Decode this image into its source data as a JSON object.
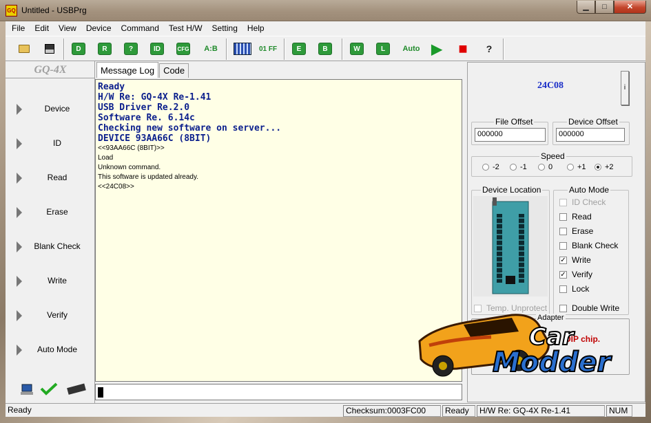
{
  "window": {
    "title": "Untitled - USBPrg",
    "app_icon": "GQ"
  },
  "window_controls": {
    "min": "▁",
    "max": "□",
    "close": "✕"
  },
  "menu": [
    "File",
    "Edit",
    "View",
    "Device",
    "Command",
    "Test H/W",
    "Setting",
    "Help"
  ],
  "toolbar": {
    "buttons": [
      {
        "name": "open-icon",
        "glyph": "📂"
      },
      {
        "name": "save-icon",
        "glyph": "💾"
      },
      {
        "name": "device-chip-icon",
        "glyph": "D"
      },
      {
        "name": "read-chip-icon",
        "glyph": "R"
      },
      {
        "name": "verify-chip-icon",
        "glyph": "?"
      },
      {
        "name": "id-chip-icon",
        "glyph": "ID"
      },
      {
        "name": "cfg-chip-icon",
        "glyph": "CFG"
      },
      {
        "name": "compare-icon",
        "glyph": "A:B"
      },
      {
        "name": "calculator-icon",
        "glyph": "▦"
      },
      {
        "name": "fill-01ff-icon",
        "glyph": "01 FF"
      },
      {
        "name": "erase-chip-icon",
        "glyph": "E"
      },
      {
        "name": "blank-chip-icon",
        "glyph": "B"
      },
      {
        "name": "write-chip-icon",
        "glyph": "W"
      },
      {
        "name": "lock-chip-icon",
        "glyph": "L"
      },
      {
        "name": "auto-icon",
        "glyph": "Auto"
      },
      {
        "name": "run-icon",
        "glyph": "▶"
      },
      {
        "name": "stop-icon",
        "glyph": "■"
      },
      {
        "name": "help-icon",
        "glyph": "?"
      }
    ]
  },
  "sidebar": {
    "logo": "GQ-4X",
    "items": [
      "Device",
      "ID",
      "Read",
      "Erase",
      "Blank Check",
      "Write",
      "Verify",
      "Auto Mode"
    ]
  },
  "tabs": [
    "Message Log",
    "Code"
  ],
  "log": {
    "big_lines": [
      "Ready",
      "H/W Re: GQ-4X Re-1.41",
      "USB Driver Re.2.0",
      "Software Re. 6.14c",
      "Checking new software on server...",
      "DEVICE 93AA66C (8BIT)"
    ],
    "small_lines": [
      "<<93AA66C (8BIT)>>",
      "Load",
      "Unknown command.",
      "This software is updated already.",
      "<<24C08>>"
    ]
  },
  "right_panel": {
    "device": "24C08",
    "info_button": "i",
    "file_offset_label": "File Offset",
    "file_offset": "000000",
    "device_offset_label": "Device Offset",
    "device_offset": "000000",
    "speed_label": "Speed",
    "speeds": [
      "-2",
      "-1",
      "0",
      "+1",
      "+2"
    ],
    "speed_selected": "+2",
    "device_location_label": "Device Location",
    "temp_unprotect": "Temp. Unprotect",
    "auto_mode_label": "Auto Mode",
    "auto_mode": [
      {
        "label": "ID Check",
        "checked": false,
        "disabled": true
      },
      {
        "label": "Read",
        "checked": false,
        "disabled": false
      },
      {
        "label": "Erase",
        "checked": false,
        "disabled": false
      },
      {
        "label": "Blank Check",
        "checked": false,
        "disabled": false
      },
      {
        "label": "Write",
        "checked": true,
        "disabled": false
      },
      {
        "label": "Verify",
        "checked": true,
        "disabled": false
      },
      {
        "label": "Lock",
        "checked": false,
        "disabled": false
      }
    ],
    "double_write": "Double Write",
    "adapter_label": "Adapter",
    "adapter_text": "DIP chip."
  },
  "watermark": {
    "line1": "Car",
    "line2": "Modder"
  },
  "statusbar": {
    "left": "Ready",
    "checksum": "Checksum:0003FC00",
    "state": "Ready",
    "hw": "H/W Re: GQ-4X Re-1.41",
    "num": "NUM"
  }
}
